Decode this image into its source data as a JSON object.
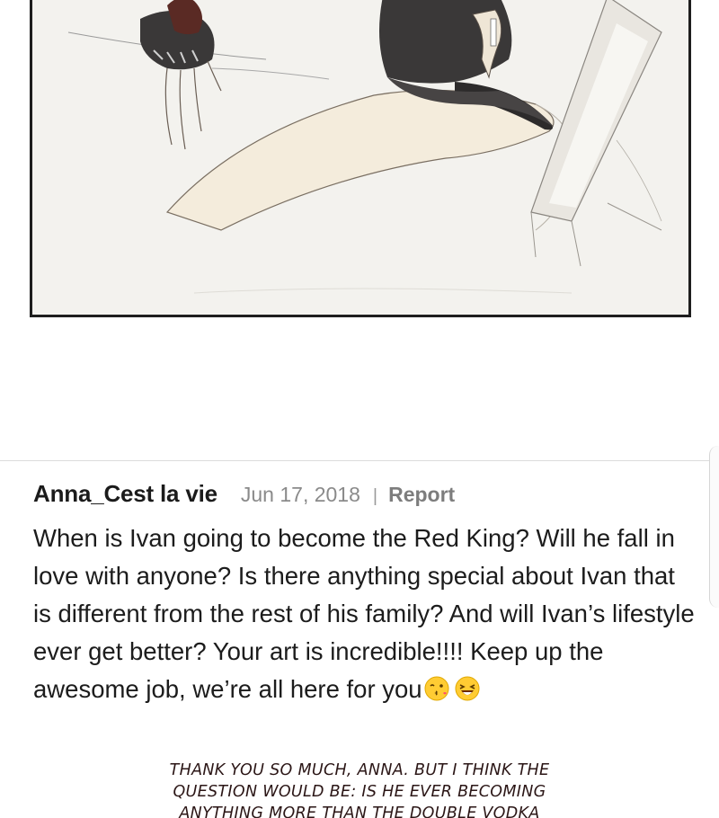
{
  "comment": {
    "author": "Anna_Cest la vie",
    "date": "Jun 17, 2018",
    "separator": "|",
    "report_label": "Report",
    "body": "When is Ivan going to become the Red King? Will he fall in love with anyone? Is there anything special about Ivan that is different from the rest of his family? And will Ivan’s lifestyle ever get better? Your art is incredible!!!! Keep up the awesome job, we’re all here for you",
    "emojis": [
      "kissing-face-icon",
      "laughing-face-icon"
    ]
  },
  "reply": {
    "lines": [
      "THANK YOU SO MUCH, ANNA. BUT I THINK THE",
      "QUESTION WOULD BE: IS HE EVER BECOMING",
      "ANYTHING MORE THAN THE DOUBLE VODKA"
    ]
  },
  "colors": {
    "reply_text": "#2b1616",
    "panel_border": "#1e1e1e",
    "meta_gray": "#8a8a8a"
  }
}
